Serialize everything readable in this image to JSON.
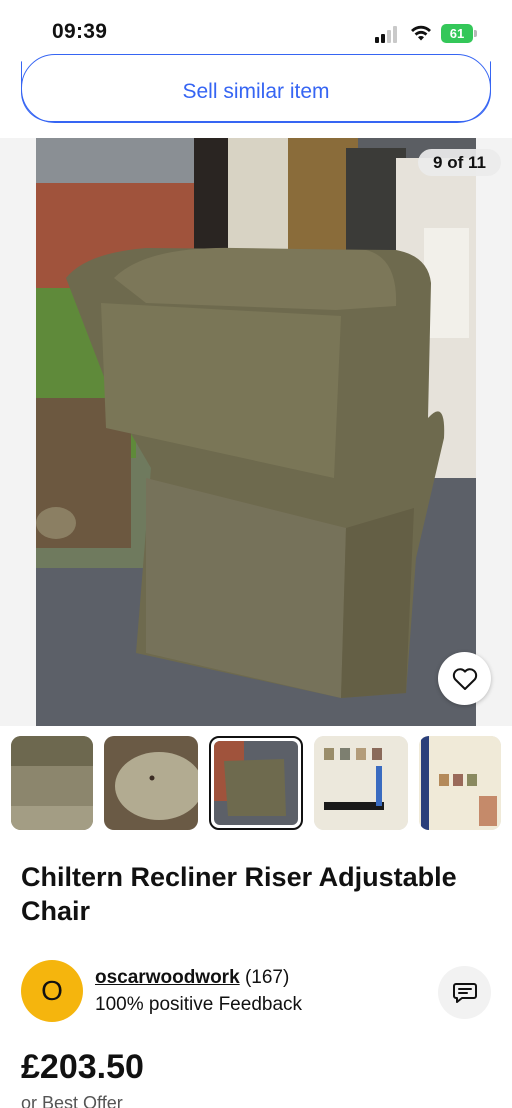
{
  "status_bar": {
    "time": "09:39",
    "battery": "61",
    "colors": {
      "battery": "#34c759"
    }
  },
  "sell_similar": {
    "label": "Sell similar item",
    "color": "#3665f3"
  },
  "gallery": {
    "counter": "9 of 11",
    "current_index": 9,
    "total": 11,
    "thumbnails": [
      {
        "name": "fabric-closeup"
      },
      {
        "name": "armrest-closeup"
      },
      {
        "name": "chair-back",
        "selected": true
      },
      {
        "name": "colour-chart"
      },
      {
        "name": "riser-recliners-brochure"
      }
    ]
  },
  "listing": {
    "title": "Chiltern Recliner Riser Adjustable Chair",
    "price": "£203.50",
    "best_offer": "or Best Offer"
  },
  "seller": {
    "avatar_letter": "O",
    "name": "oscarwoodwork",
    "count": "(167)",
    "feedback": "100% positive Feedback",
    "avatar_color": "#f5b50d"
  },
  "icons": {
    "watch": "heart-icon",
    "message": "message-icon"
  }
}
